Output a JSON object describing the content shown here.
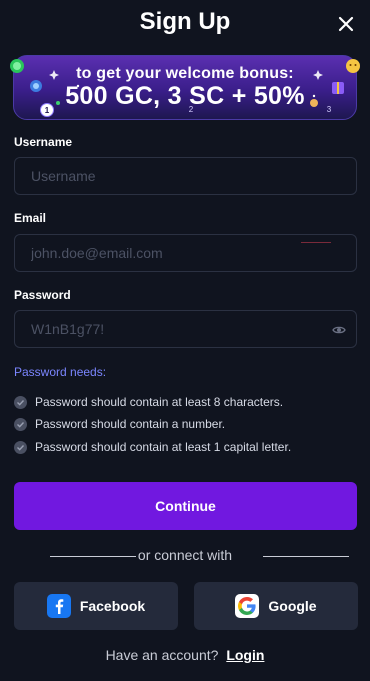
{
  "header": {
    "title": "Sign Up",
    "close_icon": "close-icon"
  },
  "banner": {
    "line1": "to get your welcome bonus:",
    "line2": "500 GC, 3 SC + 50%",
    "steps": [
      "1",
      "2",
      "3"
    ],
    "active_step": 1
  },
  "form": {
    "username": {
      "label": "Username",
      "placeholder": "Username",
      "value": ""
    },
    "email": {
      "label": "Email",
      "placeholder": "john.doe@email.com",
      "value": ""
    },
    "password": {
      "label": "Password",
      "placeholder": "W1nB1g77!",
      "value": "",
      "eye_icon": "eye-icon"
    }
  },
  "password_rules": {
    "title": "Password needs:",
    "items": [
      "Password should contain at least 8 characters.",
      "Password should contain a number.",
      "Password should contain at least 1 capital letter."
    ]
  },
  "actions": {
    "continue_label": "Continue",
    "connect_text": "or connect with",
    "facebook_label": "Facebook",
    "google_label": "Google"
  },
  "footer": {
    "text": "Have an account?",
    "login_label": "Login"
  },
  "colors": {
    "background": "#10141f",
    "accent": "#7118e0",
    "social_bg": "#242a3b",
    "link_blue": "#7b86ff",
    "banner_purple": "#5a2fb0"
  }
}
